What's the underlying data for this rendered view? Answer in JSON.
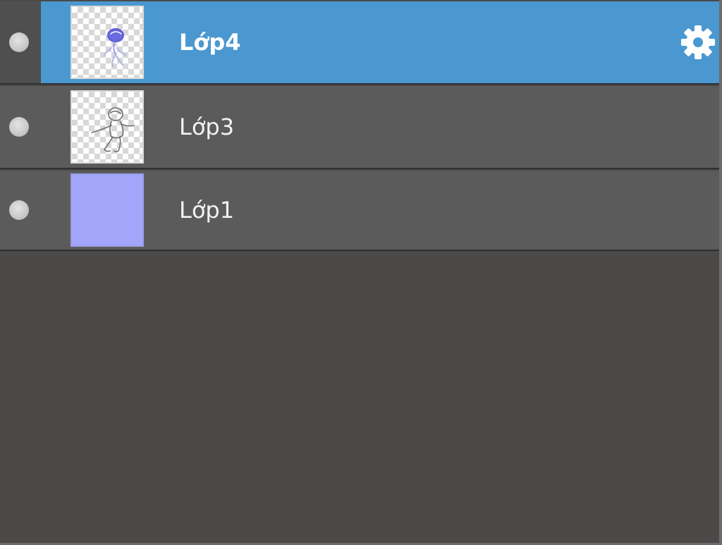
{
  "layers": [
    {
      "name": "Lớp4",
      "selected": true,
      "thumbnail": "blue-sketch-figure",
      "has_settings": true
    },
    {
      "name": "Lớp3",
      "selected": false,
      "thumbnail": "gray-sketch-figure",
      "has_settings": false
    },
    {
      "name": "Lớp1",
      "selected": false,
      "thumbnail": "solid-fill",
      "fill_color": "#a4a6fb",
      "has_settings": false
    }
  ],
  "colors": {
    "selected": "#4b98d0",
    "row": "#5b5b5b",
    "empty_area": "#4a4948"
  },
  "icons": {
    "visibility": "visibility-dot-icon",
    "settings": "gear-icon"
  }
}
